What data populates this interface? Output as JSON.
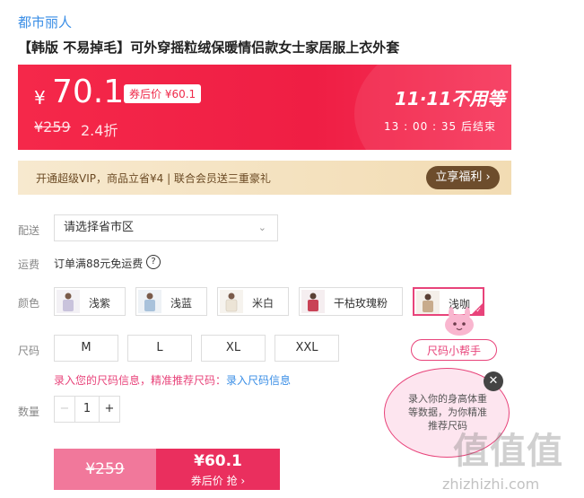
{
  "store": {
    "name": "都市丽人"
  },
  "product": {
    "title": "【韩版 不易掉毛】可外穿摇粒绒保暖情侣款女士家居服上衣外套"
  },
  "price_banner": {
    "currency": "¥",
    "price": "70.1",
    "coupon_price_tag": "券后价 ¥60.1",
    "original_price": "¥259",
    "discount": "2.4折",
    "promo_title": "11·11不用等",
    "countdown": "13 : 00 : 35  后结束"
  },
  "vip": {
    "text": "开通超级VIP，商品立省¥4 | 联合会员送三重豪礼",
    "button_label": "立享福利 ›"
  },
  "delivery": {
    "label": "配送",
    "placeholder": "请选择省市区"
  },
  "shipping": {
    "label": "运费",
    "text": "订单满88元免运费",
    "help_icon": "?"
  },
  "color": {
    "label": "颜色",
    "options": [
      {
        "label": "浅紫",
        "swatch": "#c9c3dc"
      },
      {
        "label": "浅蓝",
        "swatch": "#a9c2db"
      },
      {
        "label": "米白",
        "swatch": "#ece4d6"
      },
      {
        "label": "干枯玫瑰粉",
        "swatch": "#c94256"
      },
      {
        "label": "浅咖",
        "swatch": "#c8ab8c"
      }
    ],
    "selected": "浅咖"
  },
  "size": {
    "label": "尺码",
    "options": [
      "M",
      "L",
      "XL",
      "XXL"
    ],
    "info_text": "录入您的尺码信息，精准推荐尺码：",
    "info_link": "录入尺码信息"
  },
  "quantity": {
    "label": "数量",
    "value": "1",
    "minus": "−",
    "plus": "+"
  },
  "buy": {
    "original_price": "¥259",
    "coupon_price": "¥60.1",
    "coupon_label": "券后价 抢 ›"
  },
  "size_helper": {
    "chip_label": "尺码小帮手",
    "bubble_text": "录入你的身高体重等数据，为你精准推荐尺码",
    "close": "✕"
  },
  "watermark": {
    "big": "值值值",
    "small": "zhizhizhi.com"
  },
  "colors": {
    "accent": "#ef1e44",
    "pink": "#e8437a",
    "link": "#3a8ee6",
    "vip_brown": "#6d4d2c"
  }
}
